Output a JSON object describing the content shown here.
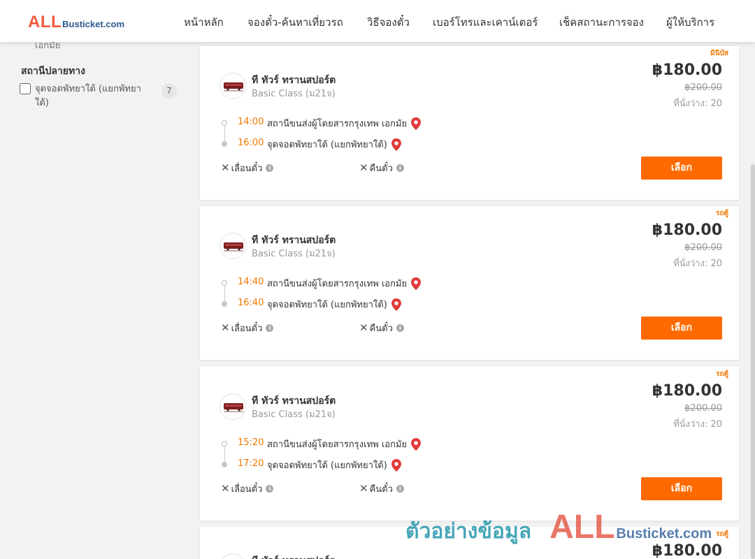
{
  "header": {
    "logo_all": "ALL",
    "logo_rest": "Busticket.com",
    "nav": [
      "หน้าหลัก",
      "จองตั๋ว-ค้นหาเที่ยวรถ",
      "วิธีจองตั๋ว",
      "เบอร์โทรและเคาน์เตอร์",
      "เช็คสถานะการจอง",
      "ผู้ให้บริการ"
    ]
  },
  "sidebar": {
    "cut_text": "เอกมัย",
    "section_title": "สถานีปลายทาง",
    "filter": {
      "label": "จุดจอดพัทยาใต้ (แยกพัทยาใต้)",
      "count": "7",
      "checked": false
    }
  },
  "trips": [
    {
      "badge": "มินิบัส",
      "operator": "ที ทัวร์ ทรานสปอร์ต",
      "class": "Basic Class (ม21จ)",
      "price": "฿180.00",
      "old_price": "฿200.00",
      "seats": "ที่นั่งว่าง: 20",
      "dep_time": "14:00",
      "dep_stop": "สถานีขนส่งผู้โดยสารกรุงเทพ เอกมัย",
      "arr_time": "16:00",
      "arr_stop": "จุดจอดพัทยาใต้ (แยกพัทยาใต้)",
      "opt1": "เลื่อนตั๋ว",
      "opt2": "คืนตั๋ว",
      "button": "เลือก"
    },
    {
      "badge": "รถตู้",
      "operator": "ที ทัวร์ ทรานสปอร์ต",
      "class": "Basic Class (ม21จ)",
      "price": "฿180.00",
      "old_price": "฿200.00",
      "seats": "ที่นั่งว่าง: 20",
      "dep_time": "14:40",
      "dep_stop": "สถานีขนส่งผู้โดยสารกรุงเทพ เอกมัย",
      "arr_time": "16:40",
      "arr_stop": "จุดจอดพัทยาใต้ (แยกพัทยาใต้)",
      "opt1": "เลื่อนตั๋ว",
      "opt2": "คืนตั๋ว",
      "button": "เลือก"
    },
    {
      "badge": "รถตู้",
      "operator": "ที ทัวร์ ทรานสปอร์ต",
      "class": "Basic Class (ม21จ)",
      "price": "฿180.00",
      "old_price": "฿200.00",
      "seats": "ที่นั่งว่าง: 20",
      "dep_time": "15:20",
      "dep_stop": "สถานีขนส่งผู้โดยสารกรุงเทพ เอกมัย",
      "arr_time": "17:20",
      "arr_stop": "จุดจอดพัทยาใต้ (แยกพัทยาใต้)",
      "opt1": "เลื่อนตั๋ว",
      "opt2": "คืนตั๋ว",
      "button": "เลือก"
    },
    {
      "badge": "รถตู้",
      "operator": "ที ทัวร์ ทรานสปอร์ต",
      "price": "฿180.00"
    }
  ],
  "watermark": {
    "text": "ตัวอย่างข้อมูล",
    "logo_all": "ALL",
    "logo_rest": "Busticket.com"
  },
  "colors": {
    "accent": "#ff6a00",
    "time": "#f07800",
    "brand_red": "#f05a3c",
    "brand_blue": "#2b5a8c",
    "pin": "#e03a3a"
  },
  "icons": {
    "pin": "map-pin-icon",
    "x": "x-icon",
    "info": "info-icon",
    "checkbox": "checkbox-icon",
    "bus": "bus-icon"
  }
}
